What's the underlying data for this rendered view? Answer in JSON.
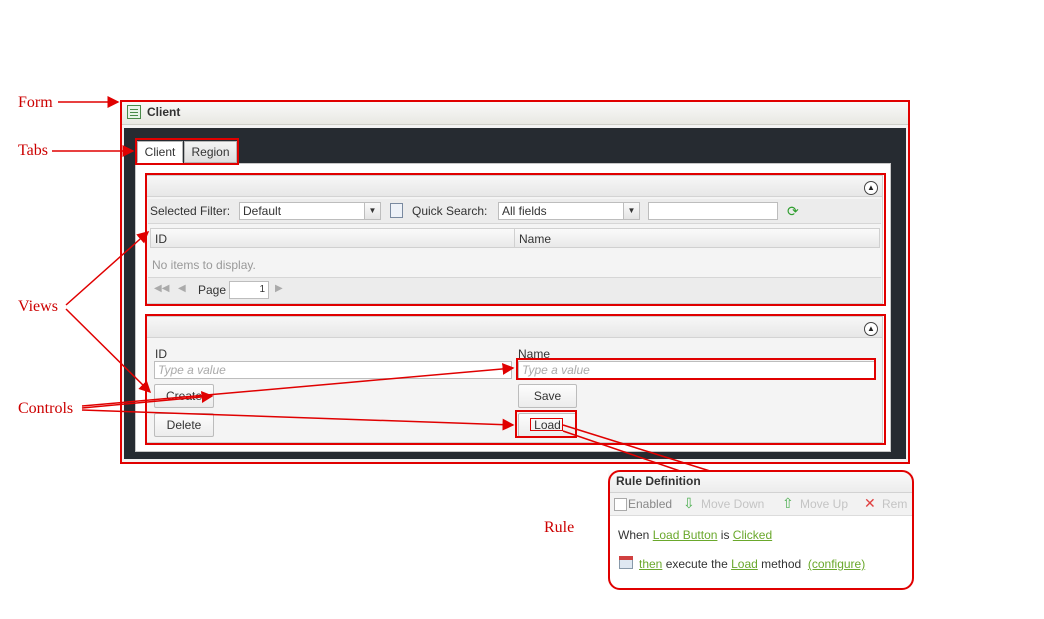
{
  "annotations": {
    "form": "Form",
    "tabs": "Tabs",
    "views": "Views",
    "controls": "Controls",
    "rule": "Rule"
  },
  "form": {
    "title": "Client",
    "tabs": [
      {
        "label": "Client",
        "active": true
      },
      {
        "label": "Region",
        "active": false
      }
    ]
  },
  "list_view": {
    "filter_label": "Selected Filter:",
    "filter_value": "Default",
    "quick_search_label": "Quick Search:",
    "quick_search_scope": "All fields",
    "search_value": "",
    "columns": [
      "ID",
      "Name"
    ],
    "empty_message": "No items to display.",
    "pager": {
      "page_label": "Page",
      "page_number": "1"
    }
  },
  "item_view": {
    "id_label": "ID",
    "id_placeholder": "Type a value",
    "name_label": "Name",
    "name_placeholder": "Type a value",
    "create_button": "Create",
    "delete_button": "Delete",
    "save_button": "Save",
    "load_button": "Load"
  },
  "rule": {
    "title": "Rule Definition",
    "toolbar": {
      "enabled": "Enabled",
      "move_down": "Move Down",
      "move_up": "Move Up",
      "remove": "Rem"
    },
    "line1": {
      "when": "When",
      "subject": "Load Button",
      "is": "is",
      "event": "Clicked"
    },
    "line2": {
      "then": "then",
      "execute": "execute the",
      "method": "Load",
      "method_word": "method",
      "configure": "(configure)"
    }
  },
  "colors": {
    "annotation": "#cc0000",
    "link": "#6aa82c",
    "dark_canvas": "#262b31"
  }
}
